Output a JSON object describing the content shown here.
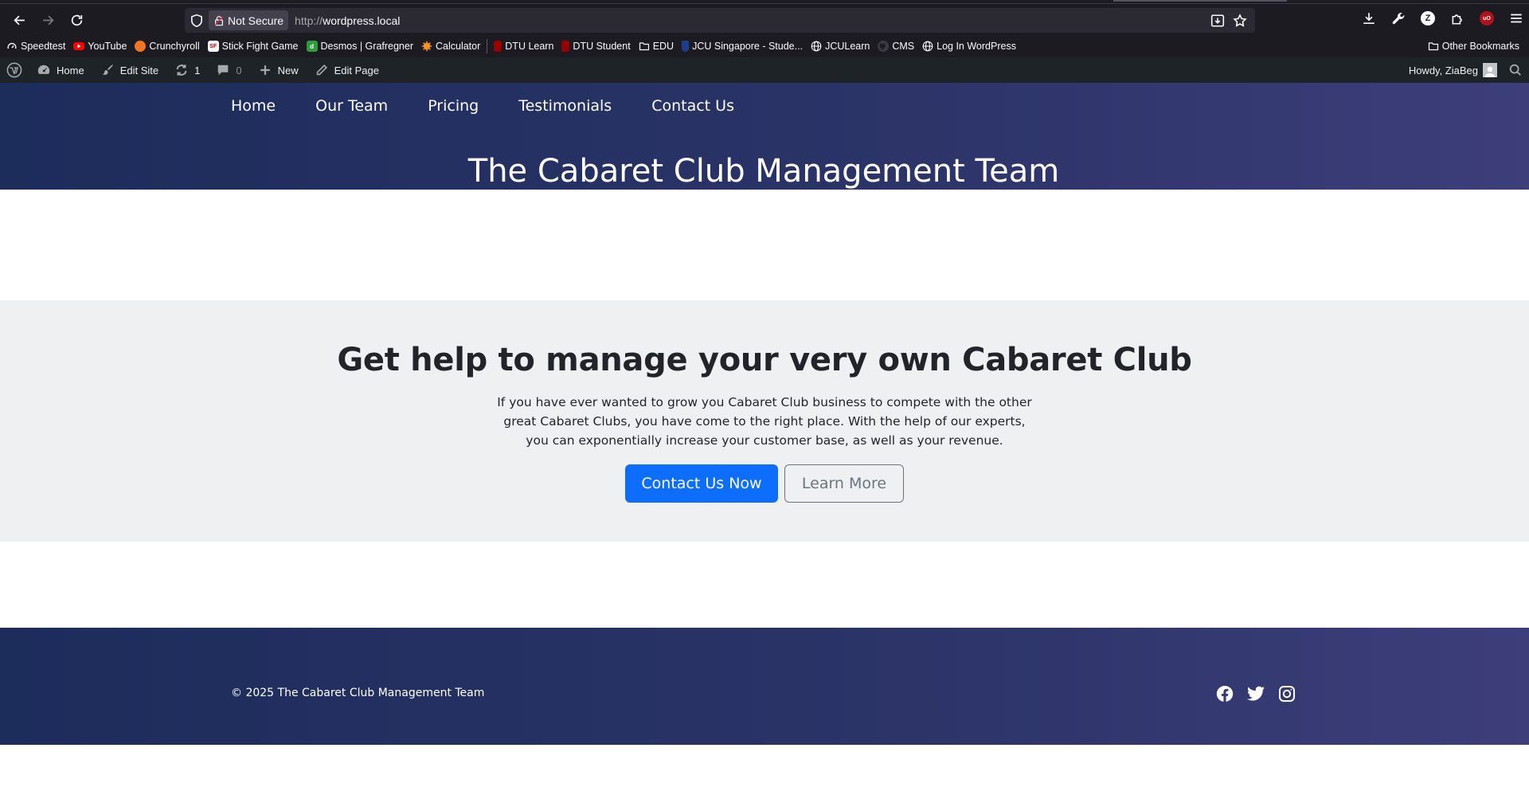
{
  "browser": {
    "url_security": "Not Secure",
    "url_protocol": "http://",
    "url_host": "wordpress.local"
  },
  "bookmarks": [
    {
      "label": "Speedtest",
      "icon": "speedtest-icon"
    },
    {
      "label": "YouTube",
      "icon": "youtube-icon",
      "color": "#ff0000"
    },
    {
      "label": "Crunchyroll",
      "icon": "crunchyroll-icon",
      "color": "#f47521"
    },
    {
      "label": "Stick Fight Game",
      "icon": "stickfight-icon"
    },
    {
      "label": "Desmos | Grafregner",
      "icon": "desmos-icon",
      "color": "#2f9c3d"
    },
    {
      "label": "Calculator",
      "icon": "calculator-icon",
      "color": "#f7931e"
    },
    {
      "label": "DTU Learn",
      "icon": "dtu-icon",
      "color": "#990000"
    },
    {
      "label": "DTU Student",
      "icon": "dtu-icon",
      "color": "#990000"
    },
    {
      "label": "EDU",
      "icon": "folder-icon"
    },
    {
      "label": "JCU Singapore - Stude...",
      "icon": "jcu-icon",
      "color": "#1e3c8c"
    },
    {
      "label": "JCULearn",
      "icon": "globe-icon"
    },
    {
      "label": "CMS",
      "icon": "github-icon"
    },
    {
      "label": "Log In WordPress",
      "icon": "globe-icon"
    }
  ],
  "other_bookmarks": "Other Bookmarks",
  "adminbar": {
    "home": "Home",
    "edit_site": "Edit Site",
    "updates_count": "1",
    "comments_count": "0",
    "new": "New",
    "edit_page": "Edit Page",
    "howdy": "Howdy, ZiaBeg"
  },
  "site": {
    "nav": [
      "Home",
      "Our Team",
      "Pricing",
      "Testimonials",
      "Contact Us"
    ],
    "title": "The Cabaret Club Management Team"
  },
  "hero": {
    "heading": "Get help to manage your very own Cabaret Club",
    "body": "If you have ever wanted to grow you Cabaret Club business to compete with the other great Cabaret Clubs, you have come to the right place. With the help of our experts, you can exponentially increase your customer base, as well as your revenue.",
    "primary_button": "Contact Us Now",
    "secondary_button": "Learn More"
  },
  "footer": {
    "copyright": "© 2025 The Cabaret Club Management Team",
    "social": [
      "facebook-icon",
      "twitter-icon",
      "instagram-icon"
    ]
  },
  "colors": {
    "header_gradient_start": "#1c2c5b",
    "header_gradient_end": "#3d3e7a",
    "hero_bg": "#eff0f2",
    "primary": "#0d6efd",
    "secondary": "#6c757d"
  }
}
